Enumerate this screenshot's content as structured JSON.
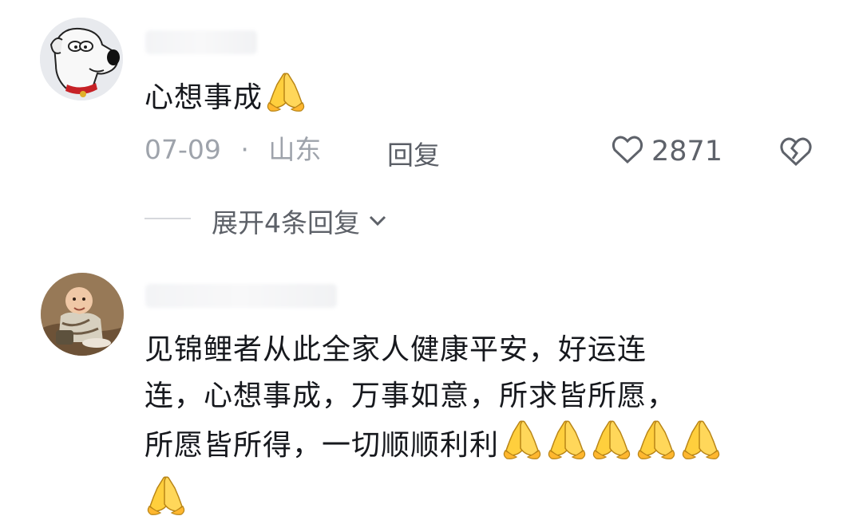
{
  "comments": [
    {
      "text": "心想事成",
      "date": "07-09",
      "separator": "·",
      "location": "山东",
      "reply_label": "回复",
      "like_count": "2871",
      "expand_label": "展开4条回复"
    },
    {
      "text_lines": [
        "见锦鲤者从此全家人健康平安，好运连",
        "连，心想事成，万事如意，所求皆所愿，",
        "所愿皆所得，一切顺顺利利"
      ]
    }
  ],
  "icons": {
    "emoji": "folded-hands-emoji",
    "like": "heart-outline-icon",
    "dislike": "broken-heart-icon",
    "expand": "chevron-down-icon"
  }
}
